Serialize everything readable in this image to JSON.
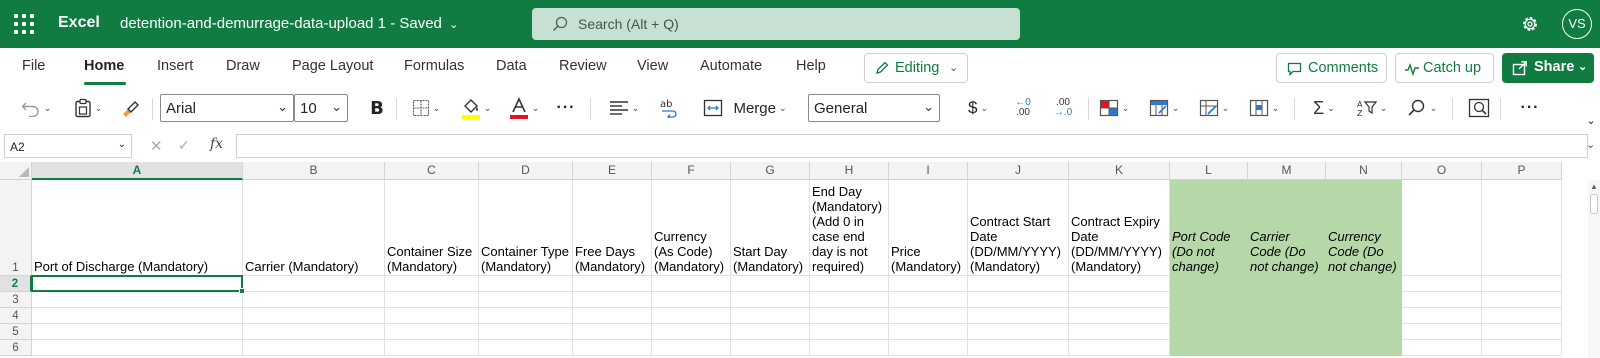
{
  "app": {
    "name": "Excel",
    "doc_title": "detention-and-demurrage-data-upload 1",
    "saved_status": "Saved",
    "search_placeholder": "Search (Alt + Q)",
    "user_initials": "VS"
  },
  "menu": {
    "tabs": [
      "File",
      "Home",
      "Insert",
      "Draw",
      "Page Layout",
      "Formulas",
      "Data",
      "Review",
      "View",
      "Automate",
      "Help"
    ],
    "active_tab": "Home",
    "editing_label": "Editing",
    "comments_label": "Comments",
    "catchup_label": "Catch up",
    "share_label": "Share"
  },
  "ribbon": {
    "font_name": "Arial",
    "font_size": "10",
    "bold_label": "B",
    "merge_label": "Merge",
    "number_format": "General",
    "currency_symbol": "$",
    "decrease_decimal_top": "←0",
    "decrease_decimal_bottom": ".00",
    "increase_decimal_top": ".00",
    "increase_decimal_bottom": "→.0",
    "more_label": "···",
    "font_color": "#e81123",
    "highlight_color": "#ffff00"
  },
  "formula_bar": {
    "name_box": "A2",
    "fx_label": "fx",
    "formula": ""
  },
  "sheet": {
    "columns": [
      "A",
      "B",
      "C",
      "D",
      "E",
      "F",
      "G",
      "H",
      "I",
      "J",
      "K",
      "L",
      "M",
      "N",
      "O",
      "P"
    ],
    "selected_column": "A",
    "rows": [
      "1",
      "2",
      "3",
      "4",
      "5",
      "6"
    ],
    "selected_row": "2",
    "header_row": [
      "Port of Discharge (Mandatory)",
      "Carrier (Mandatory)",
      "Container Size (Mandatory)",
      "Container Type (Mandatory)",
      "Free Days (Mandatory)",
      "Currency (As Code) (Mandatory)",
      "Start Day (Mandatory)",
      "End Day (Mandatory) (Add 0 in case end day is not required)",
      "Price (Mandatory)",
      "Contract Start Date (DD/MM/YYYY) (Mandatory)",
      "Contract Expiry Date (DD/MM/YYYY) (Mandatory)",
      "Port Code (Do not change)",
      "Carrier Code (Do not change)",
      "Currency Code (Do not change)",
      "",
      ""
    ],
    "green_fill": "#b6d7a8",
    "accent": "#107c41"
  }
}
